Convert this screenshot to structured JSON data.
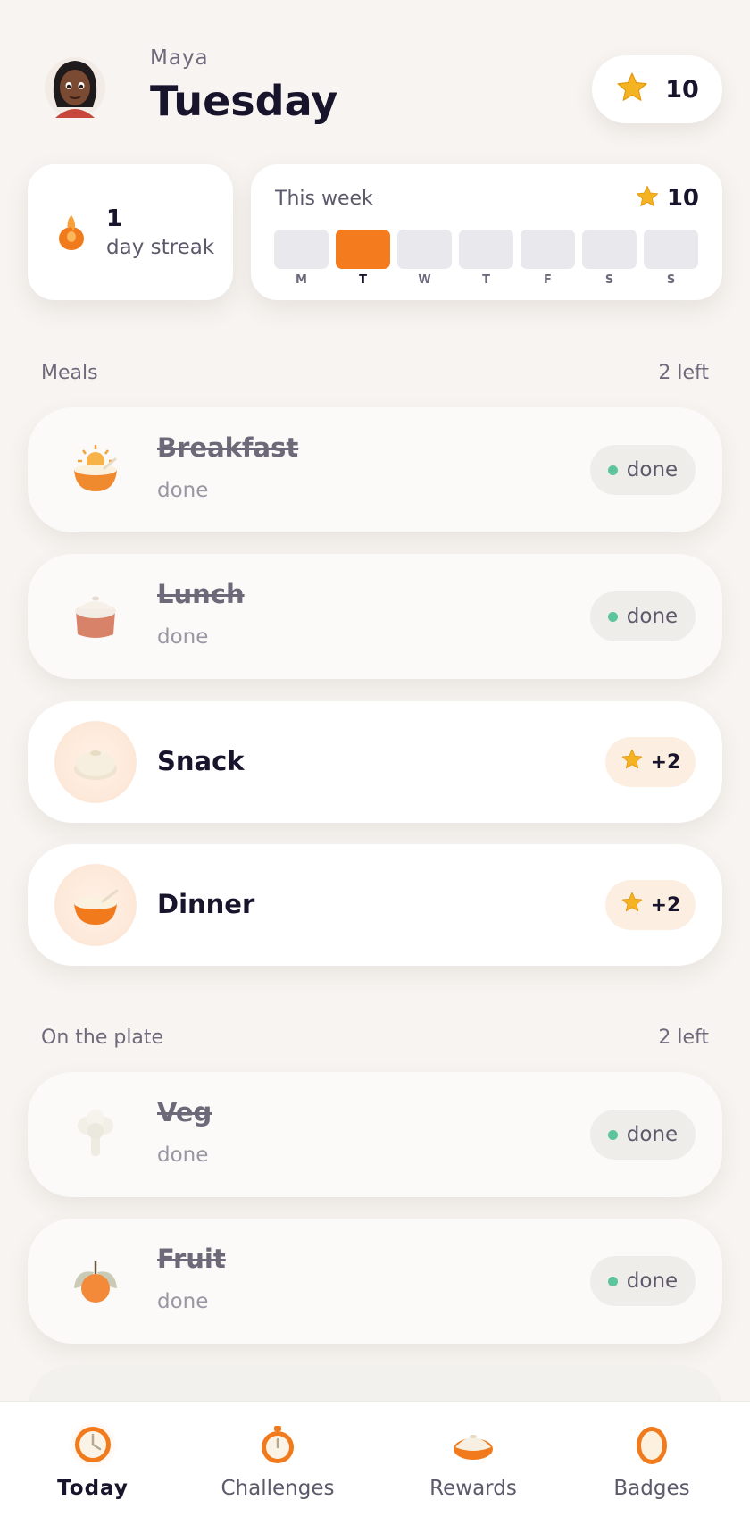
{
  "header": {
    "name": "Maya",
    "day": "Tuesday",
    "stars": "10"
  },
  "streak": {
    "count": "1",
    "label": "day streak"
  },
  "week": {
    "title": "This week",
    "stars": "10",
    "days": [
      "M",
      "T",
      "W",
      "T",
      "F",
      "S",
      "S"
    ],
    "active_day_index": 1
  },
  "meals": {
    "title": "Meals",
    "remaining": "2 left",
    "items": [
      {
        "name": "Breakfast",
        "status": "done",
        "badge": "done"
      },
      {
        "name": "Lunch",
        "status": "done",
        "badge": "done"
      },
      {
        "name": "Snack",
        "points": "+2"
      },
      {
        "name": "Dinner",
        "points": "+2"
      }
    ]
  },
  "plate": {
    "title": "On the plate",
    "remaining": "2 left",
    "items": [
      {
        "name": "Veg",
        "status": "done",
        "badge": "done"
      },
      {
        "name": "Fruit",
        "status": "done",
        "badge": "done"
      }
    ]
  },
  "nav": {
    "items": [
      {
        "label": "Today",
        "icon": "clock-icon"
      },
      {
        "label": "Challenges",
        "icon": "stopwatch-icon"
      },
      {
        "label": "Rewards",
        "icon": "pie-icon"
      },
      {
        "label": "Badges",
        "icon": "egg-icon"
      }
    ]
  },
  "colors": {
    "accent": "#f47c1e",
    "done_dot": "#5cc59c",
    "background": "#f7f4f1"
  }
}
